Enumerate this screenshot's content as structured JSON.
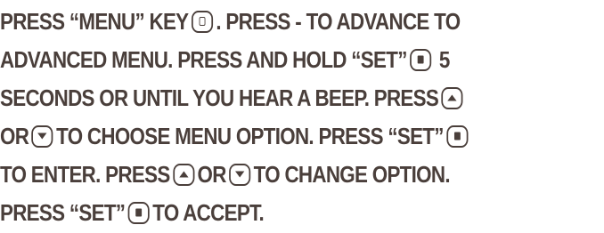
{
  "colors": {
    "text": "#4a3f3b",
    "background": "#ffffff"
  },
  "icons": {
    "menu_key": "menu-key-icon",
    "set_key": "set-key-icon",
    "up_key": "up-arrow-key-icon",
    "down_key": "down-arrow-key-icon"
  },
  "instructions": {
    "l1_a": "PRESS “MENU” KEY",
    "l1_b": ". PRESS - TO ADVANCE TO",
    "l2_a": "ADVANCED MENU.  PRESS AND HOLD “SET”",
    "l2_b": "5",
    "l3_a": "SECONDS OR UNTIL YOU HEAR A BEEP.  PRESS",
    "l4_a": "OR",
    "l4_b": "TO CHOOSE MENU OPTION. PRESS  “SET”",
    "l5_a": "TO ENTER.  PRESS",
    "l5_b": "OR",
    "l5_c": "TO CHANGE OPTION.",
    "l6_a": "PRESS “SET”",
    "l6_b": "TO ACCEPT."
  }
}
